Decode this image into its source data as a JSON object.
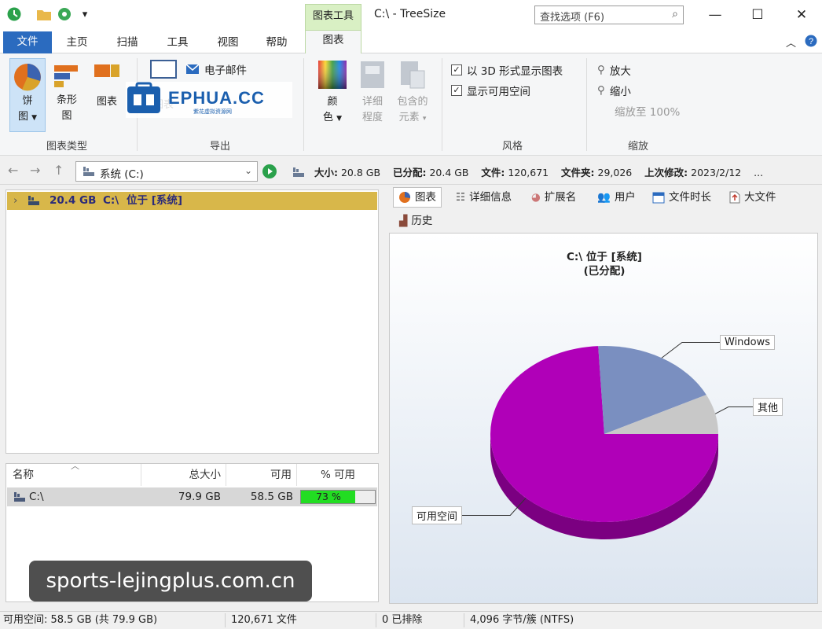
{
  "window": {
    "title": "C:\\ - TreeSize",
    "context_tab_group": "图表工具",
    "search_placeholder": "查找选项 (F6)"
  },
  "ribbon_tabs": {
    "file": "文件",
    "home": "主页",
    "scan": "扫描",
    "tools": "工具",
    "view": "视图",
    "help": "帮助",
    "chart": "图表"
  },
  "ribbon": {
    "chart_type": {
      "group_label": "图表类型",
      "pie_line1": "饼",
      "pie_line2": "图",
      "bar_line1": "条形",
      "bar_line2": "图",
      "third_label": "图表"
    },
    "export": {
      "group_label": "导出",
      "email": "电子邮件",
      "print_label": "图表"
    },
    "style_buttons": {
      "color_line1": "颜",
      "color_line2": "色",
      "detail_line1": "详细",
      "detail_line2": "程度",
      "contained_line1": "包含的",
      "contained_line2": "元素"
    },
    "style": {
      "group_label": "风格",
      "show_3d": "以 3D 形式显示图表",
      "show_free": "显示可用空间",
      "show_3d_checked": true,
      "show_free_checked": true
    },
    "zoom": {
      "group_label": "缩放",
      "zoom_in": "放大",
      "zoom_out": "缩小",
      "zoom_100": "缩放至 100%"
    }
  },
  "address": {
    "drive": "系统 (C:)",
    "size_label": "大小:",
    "size_value": "20.8 GB",
    "allocated_label": "已分配:",
    "allocated_value": "20.4 GB",
    "files_label": "文件:",
    "files_value": "120,671",
    "folders_label": "文件夹:",
    "folders_value": "29,026",
    "modified_label": "上次修改:",
    "modified_value": "2023/2/12",
    "more": "..."
  },
  "tree": {
    "row_size": "20.4 GB",
    "row_path": "C:\\",
    "row_label": "位于 [系统]"
  },
  "list": {
    "headers": [
      "名称",
      "总大小",
      "可用",
      "% 可用"
    ],
    "row": {
      "name": "C:\\",
      "total": "79.9 GB",
      "free": "58.5 GB",
      "pct_text": "73 %",
      "pct_value": 0.73
    }
  },
  "right_tabs": {
    "chart": "图表",
    "details": "详细信息",
    "extensions": "扩展名",
    "users": "用户",
    "file_age": "文件时长",
    "large_files": "大文件",
    "history": "历史"
  },
  "chart_data": {
    "type": "pie",
    "title": "C:\\  位于 [系统]",
    "subtitle": "(已分配)",
    "slices": [
      {
        "name": "可用空间",
        "value": 58.5,
        "color": "#b000b8"
      },
      {
        "name": "Windows",
        "value": 14.6,
        "color": "#7a8fc0"
      },
      {
        "name": "其他",
        "value": 5.8,
        "color": "#c8c8c8"
      }
    ],
    "three_d": true
  },
  "status": {
    "free": "可用空间: 58.5 GB (共 79.9 GB)",
    "files": "120,671 文件",
    "excluded": "0 已排除",
    "cluster": "4,096 字节/簇 (NTFS)"
  },
  "watermarks": {
    "logo_text": "EPHUA.CC",
    "logo_sub": "紫花虚拟资源网",
    "url": "sports-lejingplus.com.cn"
  }
}
